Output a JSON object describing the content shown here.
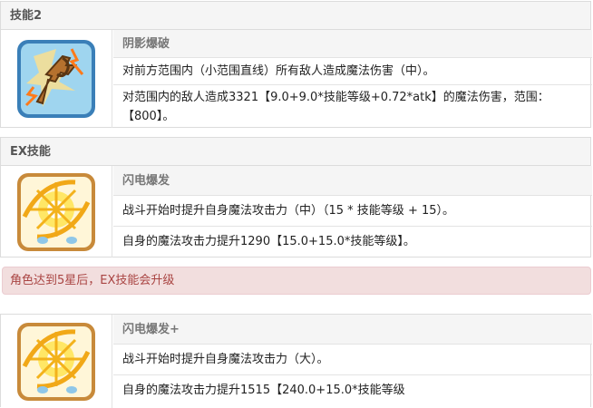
{
  "skill2": {
    "header": "技能2",
    "name": "阴影爆破",
    "desc1": "对前方范围内（小范围直线）所有敌人造成魔法伤害（中）。",
    "desc2a": "对范围内的敌人造成3321【9.0+9.0*技能等级+0.72*atk】的魔法伤害，范围：",
    "desc2b": "【800】。",
    "icon": "magic-explosion-icon"
  },
  "ex": {
    "header": "EX技能",
    "name": "闪电爆发",
    "desc1": "战斗开始时提升自身魔法攻击力（中）（15 * 技能等级 + 15）。",
    "desc2": "自身的魔法攻击力提升1290【15.0+15.0*技能等级】。",
    "icon": "lightning-burst-icon"
  },
  "notice": "角色达到5星后，EX技能会升级",
  "explus": {
    "name": "闪电爆发+",
    "desc1": "战斗开始时提升自身魔法攻击力（大）。",
    "desc2": "自身的魔法攻击力提升1515【240.0+15.0*技能等级",
    "icon": "lightning-burst-icon"
  },
  "colors": {
    "icon_frame": "#3a7fb8",
    "icon_bg": "#9fd5ef",
    "notice_bg": "#f2dede",
    "notice_text": "#a94442"
  }
}
